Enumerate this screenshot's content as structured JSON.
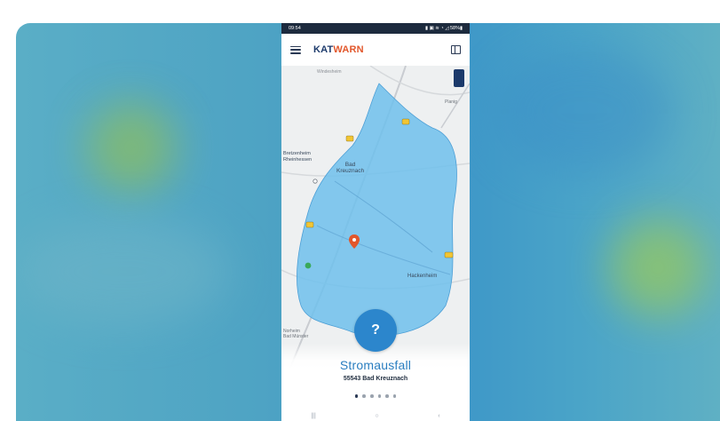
{
  "status_bar": {
    "time": "09:54",
    "indicators": "▮ ▣ ≋ ◔ ◿ 58%▮"
  },
  "app": {
    "brand_part1": "KAT",
    "brand_part2": "WARN",
    "menu_icon": "hamburger-menu-icon",
    "book_icon": "book-icon"
  },
  "map": {
    "label_top": "Windesheim",
    "label_city": "Bad\nKreuznach",
    "label_west": "Bretzenheim\nRheinhessen",
    "label_east": "Hackenheim",
    "label_ne": "Planig",
    "label_sw": "Norheim\nBad Münster",
    "marker_icon": "map-pin-icon",
    "layer_button_icon": "layers-icon"
  },
  "warning": {
    "event_icon": "?",
    "title": "Stromausfall",
    "location": "55543 Bad Kreuznach",
    "pager_count": 6,
    "pager_active": 0
  },
  "colors": {
    "accent": "#2c86cc",
    "brand_dark": "#1c3a6b",
    "brand_orange": "#e2572b",
    "area_fill": "#6fc0ec"
  }
}
